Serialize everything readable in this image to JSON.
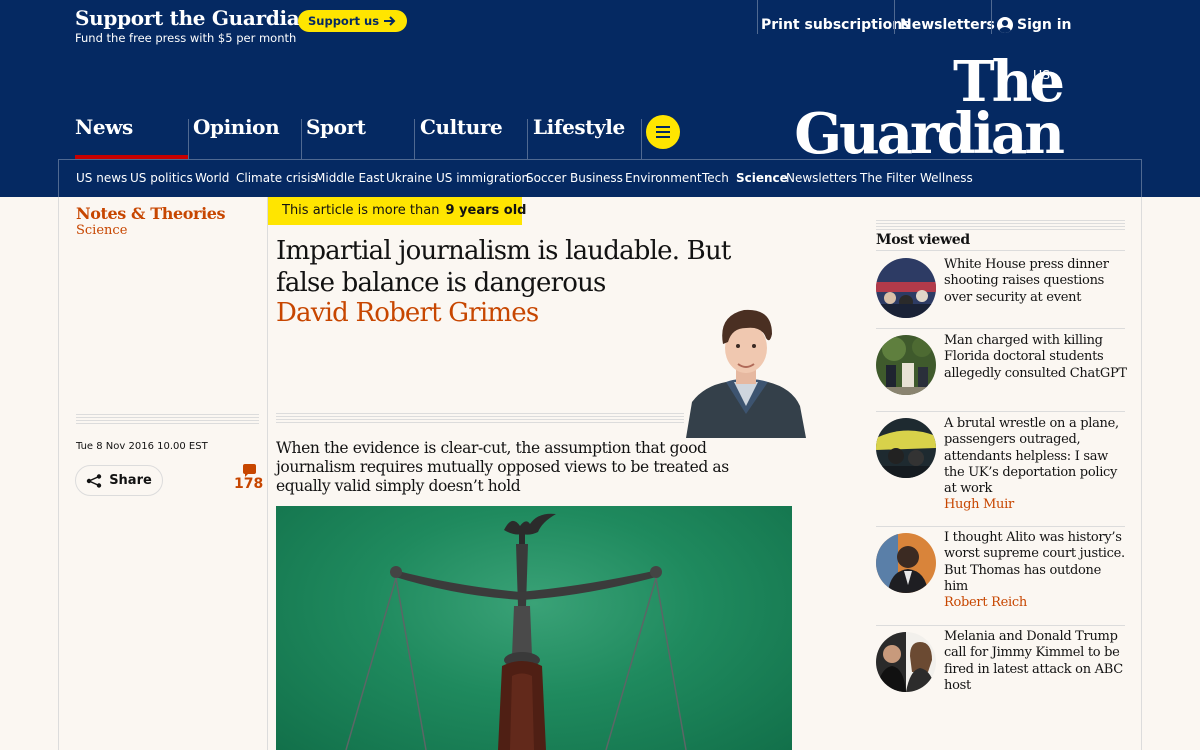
{
  "support": {
    "title": "Support the Guardian",
    "subtitle": "Fund the free press with $5 per month",
    "button_label": "Support us",
    "links": {
      "print": "Print subscriptions",
      "newsletters": "Newsletters",
      "signin": "Sign in"
    }
  },
  "masthead": {
    "edition": "US",
    "logo_line1": "The",
    "logo_line2": "Guardian",
    "pillars": [
      "News",
      "Opinion",
      "Sport",
      "Culture",
      "Lifestyle"
    ],
    "subnav": [
      "US news",
      "US politics",
      "World",
      "Climate crisis",
      "Middle East",
      "Ukraine",
      "US immigration",
      "Soccer",
      "Business",
      "Environment",
      "Tech",
      "Science",
      "Newsletters",
      "The Filter",
      "Wellness"
    ]
  },
  "article": {
    "series": "Notes & Theories",
    "section": "Science",
    "age_prefix": "This article is more than",
    "age_value": "9 years old",
    "headline": "Impartial journalism is laudable. But false balance is dangerous",
    "byline": "David Robert Grimes",
    "date": "Tue 8 Nov 2016 10.00 EST",
    "share_label": "Share",
    "comment_count": "178",
    "standfirst": "When the evidence is clear-cut, the assumption that good journalism requires mutually opposed views to be treated as equally valid simply doesn’t hold"
  },
  "most_viewed": {
    "title": "Most viewed",
    "items": [
      {
        "headline": "White House press dinner shooting raises questions over security at event",
        "author": ""
      },
      {
        "headline": "Man charged with killing Florida doctoral students allegedly consulted ChatGPT",
        "author": ""
      },
      {
        "headline": "A brutal wrestle on a plane, passengers outraged, attendants helpless: I saw the UK’s deportation policy at work",
        "author": "Hugh Muir"
      },
      {
        "headline": "I thought Alito was history’s worst supreme court justice. But Thomas has outdone him",
        "author": "Robert Reich"
      },
      {
        "headline": "Melania and Donald Trump call for Jimmy Kimmel to be fired in latest attack on ABC host",
        "author": ""
      }
    ]
  },
  "colors": {
    "brand": "#052962",
    "accent_yellow": "#ffe500",
    "opinion_orange": "#c74600",
    "news_red": "#c70000"
  }
}
